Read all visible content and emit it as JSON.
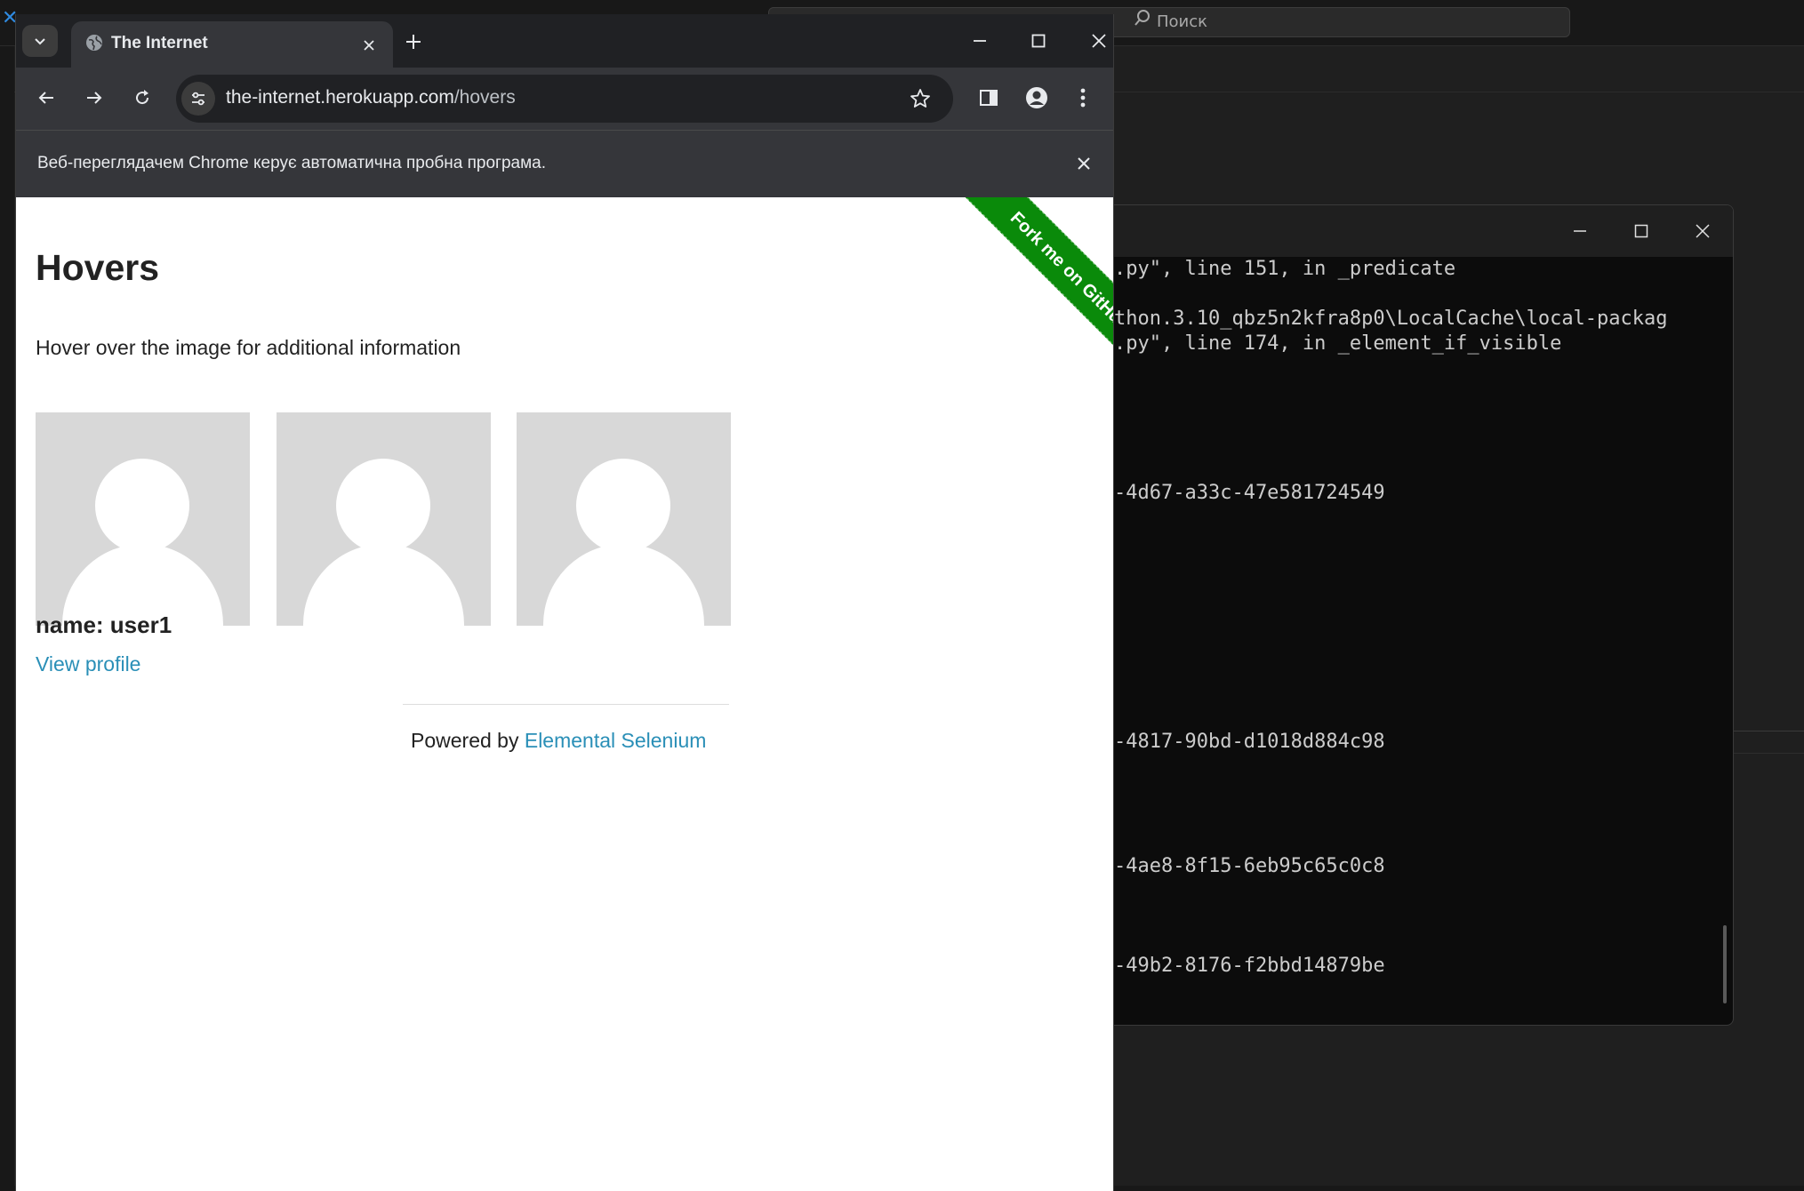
{
  "ide": {
    "search_placeholder": "Поиск"
  },
  "terminal": {
    "lines": [
      ".py\", line 151, in _predicate",
      "thon.3.10_qbz5n2kfra8p0\\LocalCache\\local-packag",
      ".py\", line 174, in _element_if_visible",
      "-4d67-a33c-47e581724549",
      "-4817-90bd-d1018d884c98",
      "-4ae8-8f15-6eb95c65c0c8",
      "-49b2-8176-f2bbd14879be"
    ]
  },
  "browser": {
    "tab_title": "The Internet",
    "url_host": "the-internet.herokuapp.com",
    "url_path": "/hovers",
    "infobar_text": "Веб-переглядачем Chrome керує автоматична пробна програма."
  },
  "page": {
    "title": "Hovers",
    "subtitle": "Hover over the image for additional information",
    "ribbon_text": "Fork me on GitHub",
    "caption_name": "name: user1",
    "caption_link": "View profile",
    "footer_prefix": "Powered by ",
    "footer_link": "Elemental Selenium"
  }
}
